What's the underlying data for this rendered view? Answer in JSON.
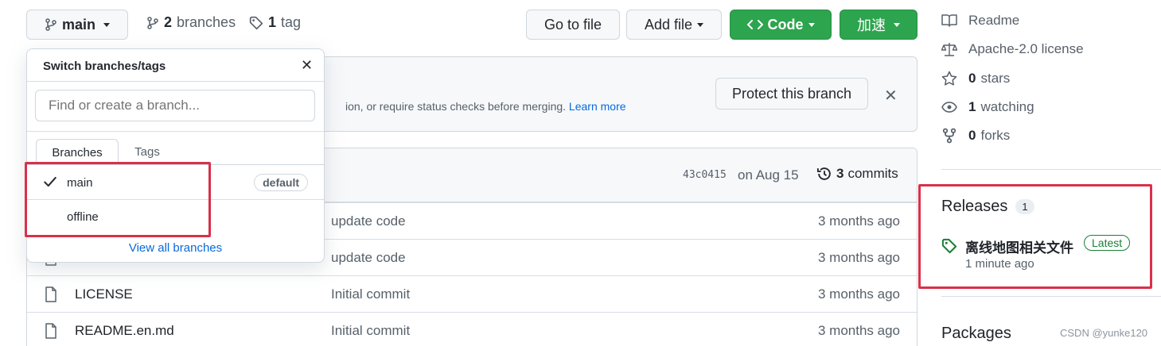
{
  "topbar": {
    "branch_label": "main",
    "branches_count": "2",
    "branches_label": "branches",
    "tags_count": "1",
    "tags_label": "tag",
    "goto_file": "Go to file",
    "add_file": "Add file",
    "code": "Code",
    "speed": "加速"
  },
  "banner": {
    "text": "ion, or require status checks before merging.",
    "learn_more": "Learn more",
    "protect_button": "Protect this branch"
  },
  "commit_header": {
    "hash": "43c0415",
    "date": "on Aug 15",
    "commits_count": "3",
    "commits_label": "commits"
  },
  "files": [
    {
      "name": "",
      "message": "update code",
      "age": "3 months ago"
    },
    {
      "name": "",
      "message": "update code",
      "age": "3 months ago"
    },
    {
      "name": "LICENSE",
      "message": "Initial commit",
      "age": "3 months ago"
    },
    {
      "name": "README.en.md",
      "message": "Initial commit",
      "age": "3 months ago"
    }
  ],
  "dropdown": {
    "title": "Switch branches/tags",
    "placeholder": "Find or create a branch...",
    "tab_branches": "Branches",
    "tab_tags": "Tags",
    "items": [
      {
        "label": "main",
        "badge": "default",
        "selected": true
      },
      {
        "label": "offline",
        "selected": false
      }
    ],
    "view_all": "View all branches"
  },
  "sidebar": {
    "readme": "Readme",
    "license": "Apache-2.0 license",
    "stars_count": "0",
    "stars_label": "stars",
    "watching_count": "1",
    "watching_label": "watching",
    "forks_count": "0",
    "forks_label": "forks",
    "releases_title": "Releases",
    "releases_count": "1",
    "release_name": "离线地图相关文件",
    "release_badge": "Latest",
    "release_time": "1 minute ago",
    "packages_title": "Packages"
  },
  "watermark": "CSDN @yunke120",
  "colors": {
    "accent_green": "#2da44e",
    "link_blue": "#0969da",
    "annotation_red": "#d9304a",
    "latest_green": "#1a7f37"
  }
}
